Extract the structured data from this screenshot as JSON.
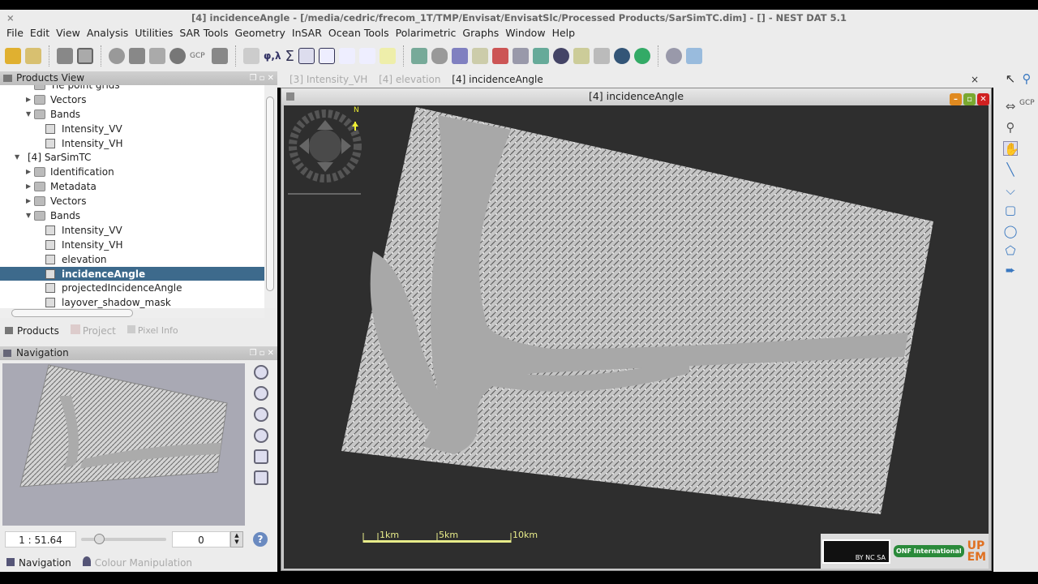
{
  "window": {
    "title": "[4] incidenceAngle - [/media/cedric/frecom_1T/TMP/Envisat/EnvisatSlc/Processed Products/SarSimTC.dim] - [] - NEST DAT 5.1",
    "close": "×"
  },
  "menu": [
    "File",
    "Edit",
    "View",
    "Analysis",
    "Utilities",
    "SAR Tools",
    "Geometry",
    "InSAR",
    "Ocean Tools",
    "Polarimetric",
    "Graphs",
    "Window",
    "Help"
  ],
  "toolbar": {
    "gcp_label": "GCP",
    "phi_lambda": "φ,λ",
    "sigma": "Σ"
  },
  "products_view": {
    "title": "Products View",
    "tree": [
      {
        "label": "Tie point grids",
        "level": 1,
        "type": "folder",
        "arrow": ""
      },
      {
        "label": "Vectors",
        "level": 1,
        "type": "folder",
        "arrow": "▶"
      },
      {
        "label": "Bands",
        "level": 1,
        "type": "folder",
        "arrow": "▼"
      },
      {
        "label": "Intensity_VV",
        "level": 2,
        "type": "band",
        "arrow": ""
      },
      {
        "label": "Intensity_VH",
        "level": 2,
        "type": "band",
        "arrow": ""
      },
      {
        "label": "[4] SarSimTC",
        "level": 0,
        "type": "product",
        "arrow": "▼"
      },
      {
        "label": "Identification",
        "level": 1,
        "type": "folder",
        "arrow": "▶"
      },
      {
        "label": "Metadata",
        "level": 1,
        "type": "folder",
        "arrow": "▶"
      },
      {
        "label": "Vectors",
        "level": 1,
        "type": "folder",
        "arrow": "▶"
      },
      {
        "label": "Bands",
        "level": 1,
        "type": "folder",
        "arrow": "▼"
      },
      {
        "label": "Intensity_VV",
        "level": 2,
        "type": "band",
        "arrow": ""
      },
      {
        "label": "Intensity_VH",
        "level": 2,
        "type": "band",
        "arrow": ""
      },
      {
        "label": "elevation",
        "level": 2,
        "type": "band",
        "arrow": ""
      },
      {
        "label": "incidenceAngle",
        "level": 2,
        "type": "band",
        "arrow": "",
        "selected": true
      },
      {
        "label": "projectedIncidenceAngle",
        "level": 2,
        "type": "band",
        "arrow": ""
      },
      {
        "label": "layover_shadow_mask",
        "level": 2,
        "type": "band",
        "arrow": ""
      }
    ],
    "tabs": [
      "Products",
      "Project",
      "Pixel Info"
    ]
  },
  "navigation": {
    "title": "Navigation",
    "scale": "1 : 51.64",
    "rotation": "0",
    "slider_fraction": 0.15,
    "tabs": [
      "Navigation",
      "Colour Manipulation"
    ]
  },
  "documents": {
    "tabs": [
      "[3] Intensity_VH",
      "[4] elevation",
      "[4] incidenceAngle"
    ],
    "active": 2,
    "close": "×"
  },
  "image_window": {
    "title": "[4] incidenceAngle",
    "north": "N",
    "scalebar": [
      "1km",
      "5km",
      "10km"
    ]
  },
  "right_tools": {
    "gcp": "GCP"
  },
  "logos": {
    "cc": "BY NC SA",
    "onf": "ONF International",
    "upem": "UP EM"
  },
  "colors": {
    "selection": "#3d6a8c",
    "canvas": "#2e2e2e",
    "scalebar": "#e8ec8a"
  }
}
